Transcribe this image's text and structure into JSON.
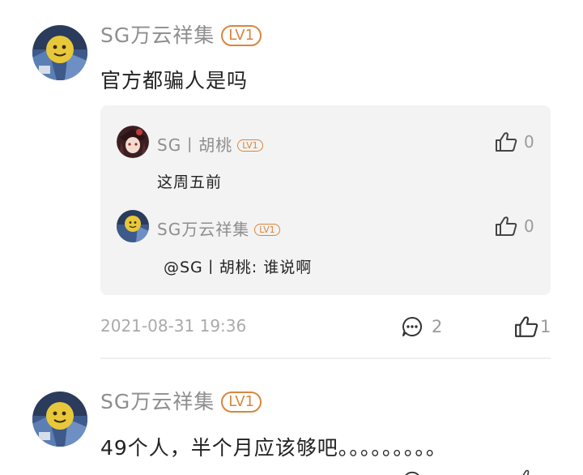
{
  "comments": [
    {
      "username": "SG万云祥集",
      "level": "LV1",
      "text": "官方都骗人是吗",
      "replies": [
        {
          "username": "SG丨胡桃",
          "level": "LV1",
          "text": "这周五前",
          "likes": "0"
        },
        {
          "username": "SG万云祥集",
          "level": "LV1",
          "text": "@SG丨胡桃: 谁说啊",
          "likes": "0"
        }
      ],
      "timestamp": "2021-08-31 19:36",
      "reply_count": "2",
      "like_count": "1"
    },
    {
      "username": "SG万云祥集",
      "level": "LV1",
      "text": "49个人，半个月应该够吧。。。。。。。。。"
    }
  ],
  "icons": {
    "like": "thumbs-up-icon",
    "comment": "comment-bubble-icon"
  },
  "colors": {
    "level_badge": "#d9863d",
    "muted_text": "#8e8e8e",
    "reply_bg": "#f3f3f3"
  }
}
